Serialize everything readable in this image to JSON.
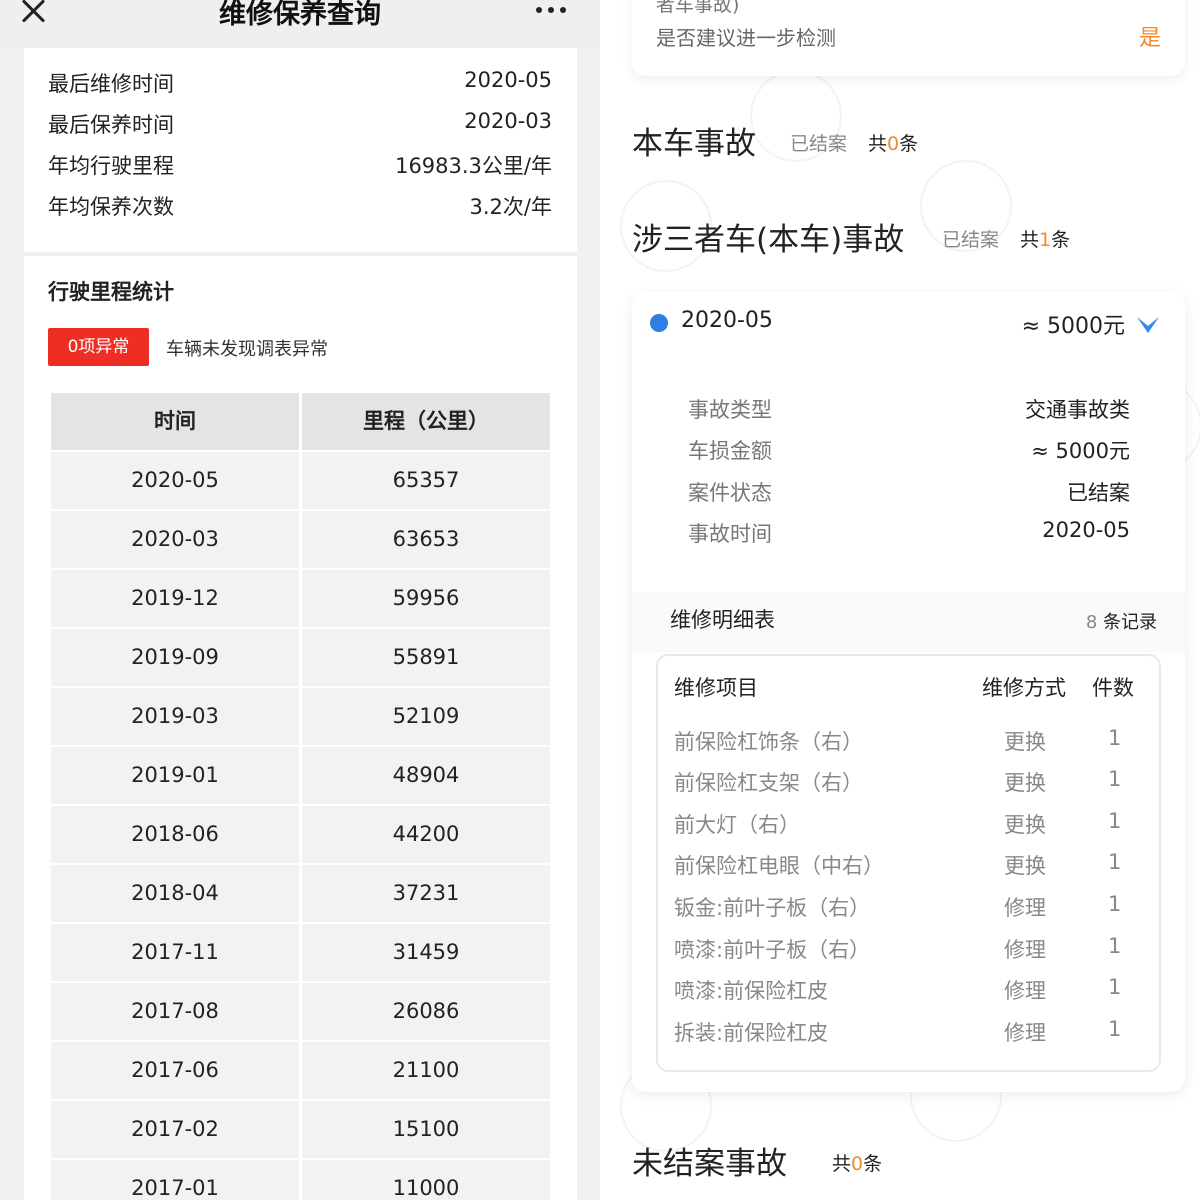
{
  "header": {
    "title": "维修保养查询"
  },
  "summary": [
    {
      "label": "最后维修时间",
      "value": "2020-05"
    },
    {
      "label": "最后保养时间",
      "value": "2020-03"
    },
    {
      "label": "年均行驶里程",
      "value": "16983.3公里/年"
    },
    {
      "label": "年均保养次数",
      "value": "3.2次/年"
    }
  ],
  "mileage": {
    "title": "行驶里程统计",
    "badge": "0项异常",
    "note": "车辆未发现调表异常",
    "columns": [
      "时间",
      "里程（公里）"
    ],
    "rows": [
      [
        "2020-05",
        "65357"
      ],
      [
        "2020-03",
        "63653"
      ],
      [
        "2019-12",
        "59956"
      ],
      [
        "2019-09",
        "55891"
      ],
      [
        "2019-03",
        "52109"
      ],
      [
        "2019-01",
        "48904"
      ],
      [
        "2018-06",
        "44200"
      ],
      [
        "2018-04",
        "37231"
      ],
      [
        "2017-11",
        "31459"
      ],
      [
        "2017-08",
        "26086"
      ],
      [
        "2017-06",
        "21100"
      ],
      [
        "2017-02",
        "15100"
      ],
      [
        "2017-01",
        "11000"
      ]
    ]
  },
  "top_card": {
    "cut_text": "者车事故)",
    "question": "是否建议进一步检测",
    "answer": "是"
  },
  "sections": {
    "own": {
      "title": "本车事故",
      "status": "已结案",
      "count_prefix": "共",
      "count": "0",
      "count_suffix": "条"
    },
    "third": {
      "title": "涉三者车(本车)事故",
      "status": "已结案",
      "count_prefix": "共",
      "count": "1",
      "count_suffix": "条"
    },
    "open": {
      "title": "未结案事故",
      "count_prefix": "共",
      "count": "0",
      "count_suffix": "条"
    }
  },
  "accident": {
    "date": "2020-05",
    "amount": "≈ 5000元",
    "details": [
      {
        "label": "事故类型",
        "value": "交通事故类"
      },
      {
        "label": "车损金额",
        "value": "≈ 5000元"
      },
      {
        "label": "案件状态",
        "value": "已结案"
      },
      {
        "label": "事故时间",
        "value": "2020-05"
      }
    ],
    "repair_title": "维修明细表",
    "repair_count": "8",
    "repair_count_suffix": " 条记录",
    "repair_columns": [
      "维修项目",
      "维修方式",
      "件数"
    ],
    "repairs": [
      [
        "前保险杠饰条（右）",
        "更换",
        "1"
      ],
      [
        "前保险杠支架（右）",
        "更换",
        "1"
      ],
      [
        "前大灯（右）",
        "更换",
        "1"
      ],
      [
        "前保险杠电眼（中右）",
        "更换",
        "1"
      ],
      [
        "钣金:前叶子板（右）",
        "修理",
        "1"
      ],
      [
        "喷漆:前叶子板（右）",
        "修理",
        "1"
      ],
      [
        "喷漆:前保险杠皮",
        "修理",
        "1"
      ],
      [
        "拆装:前保险杠皮",
        "修理",
        "1"
      ]
    ]
  },
  "colors": {
    "accent_orange": "#f08a2c",
    "badge_red": "#ee2e24",
    "dot_blue": "#2f7fe0"
  }
}
